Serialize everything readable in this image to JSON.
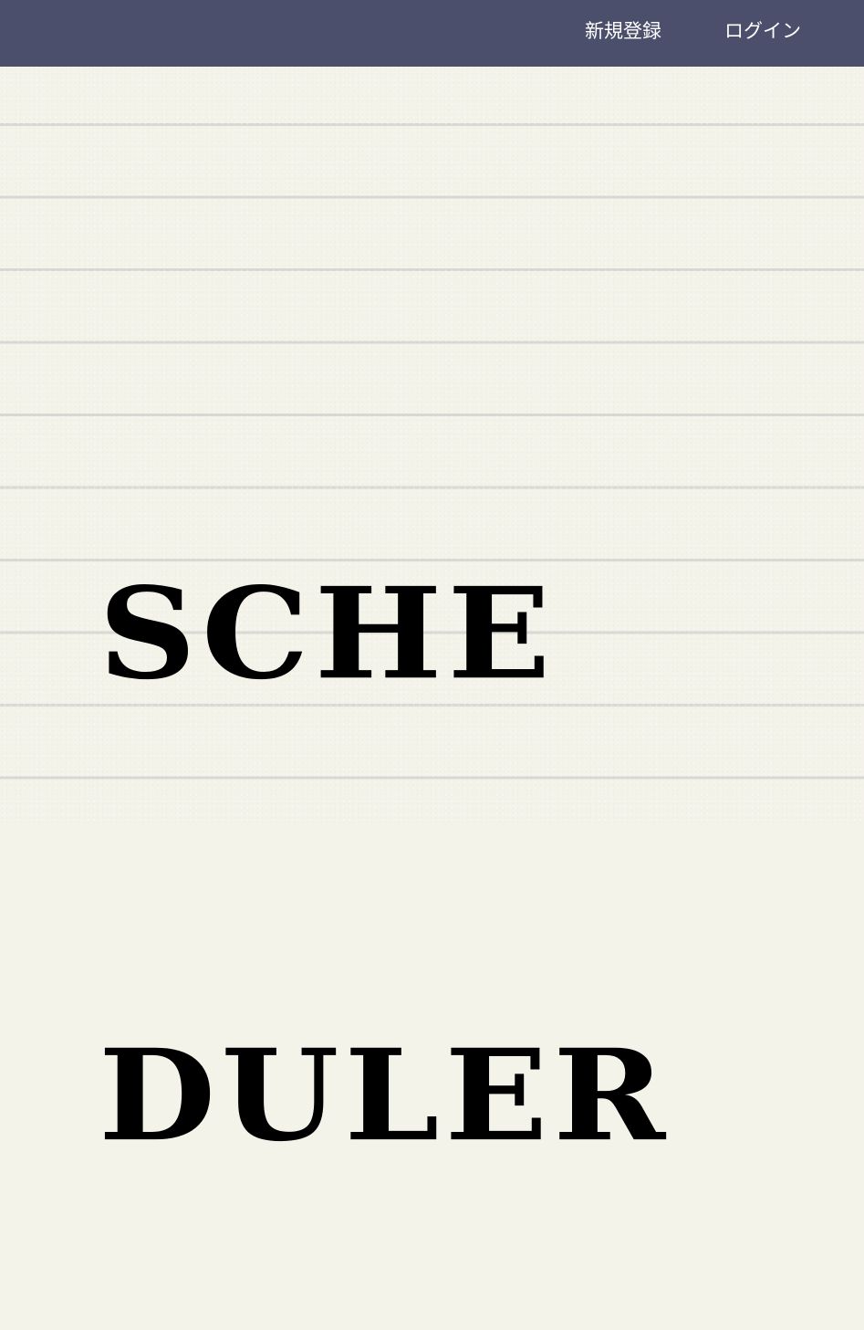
{
  "header": {
    "signup_label": "新規登録",
    "login_label": "ログイン",
    "background_color": "#4b4f6b"
  },
  "hero": {
    "logo_line_1": "SCHE",
    "logo_line_2": "DULER"
  },
  "colors": {
    "paper": "#f4f3ea",
    "ruled_line": "#d6d9d4",
    "text": "#000000"
  }
}
